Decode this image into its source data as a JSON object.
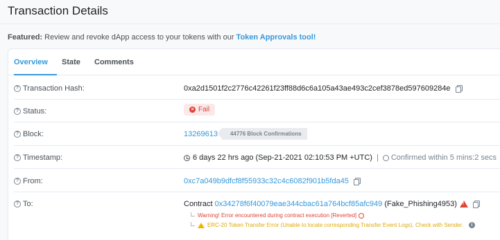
{
  "page": {
    "title": "Transaction Details"
  },
  "featured": {
    "prefix": "Featured:",
    "text": " Review and revoke dApp access to your tokens with our ",
    "link": "Token Approvals tool!"
  },
  "tabs": [
    {
      "label": "Overview",
      "active": true
    },
    {
      "label": "State",
      "active": false
    },
    {
      "label": "Comments",
      "active": false
    }
  ],
  "rows": {
    "hash": {
      "label": "Transaction Hash:",
      "value": "0xa2d1501f2c2776c42261f23ff88d6c6a105a43ae493c2cef3878ed597609284e"
    },
    "status": {
      "label": "Status:",
      "value": "Fail"
    },
    "block": {
      "label": "Block:",
      "value": "13269613",
      "confirmations": "44776 Block Confirmations"
    },
    "timestamp": {
      "label": "Timestamp:",
      "value": "6 days 22 hrs ago (Sep-21-2021 02:10:53 PM +UTC)",
      "divider": "|",
      "confirmed": "Confirmed within 5 mins:2 secs"
    },
    "from": {
      "label": "From:",
      "value": "0xc7a049b9dfcf8f55933c32c4c6082f901b5fda45"
    },
    "to": {
      "label": "To:",
      "prefix": "Contract",
      "address": "0x34278f6f40079eae344cbac61a764bcf85afc949",
      "name": "(Fake_Phishing4953)",
      "warning": "Warning! Error encountered during contract execution [Reverted]",
      "erc20": "ERC-20 Token Transfer Error (Unable to locate corresponding Transfer Event Logs), Check with Sender."
    }
  },
  "colors": {
    "accent": "#3498db",
    "error": "#de4437",
    "warning": "#e0a800"
  }
}
